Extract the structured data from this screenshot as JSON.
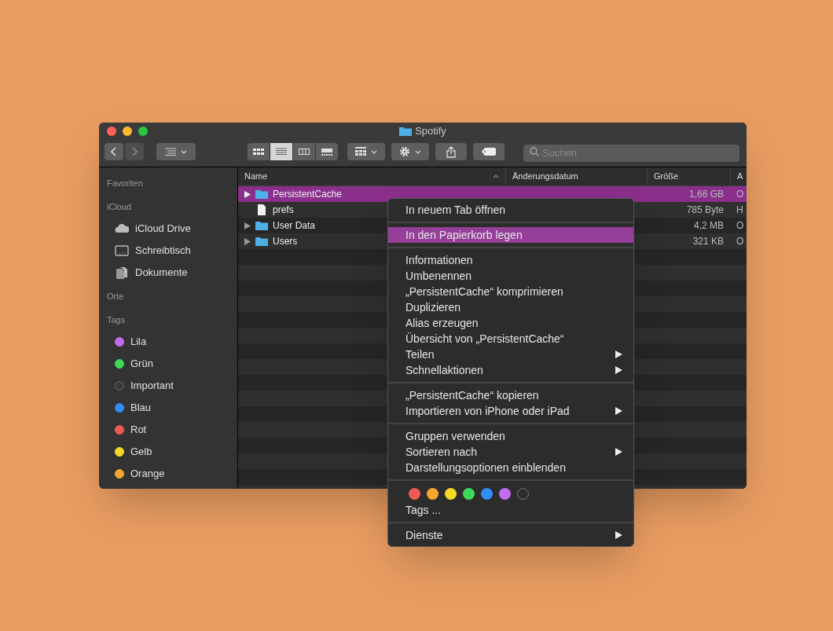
{
  "window": {
    "title": "Spotify"
  },
  "toolbar": {
    "view_modes": [
      {
        "kind": "icons",
        "selected": false
      },
      {
        "kind": "list",
        "selected": true
      },
      {
        "kind": "columns",
        "selected": false
      },
      {
        "kind": "gallery",
        "selected": false
      }
    ],
    "search": {
      "placeholder": "Suchen"
    }
  },
  "sidebar": {
    "sections": [
      {
        "title": "Favoriten"
      },
      {
        "title": "iCloud",
        "items": [
          {
            "label": "iCloud Drive",
            "kind": "cloud"
          },
          {
            "label": "Schreibtisch",
            "kind": "desktop"
          },
          {
            "label": "Dokumente",
            "kind": "documents"
          }
        ]
      },
      {
        "title": "Orte"
      },
      {
        "title": "Tags",
        "items": [
          {
            "label": "Lila",
            "color": "#c26cf0"
          },
          {
            "label": "Grün",
            "color": "#3fd95a"
          },
          {
            "label": "Important",
            "color": "#3a3a3a"
          },
          {
            "label": "Blau",
            "color": "#2f8ff5"
          },
          {
            "label": "Rot",
            "color": "#f05a55"
          },
          {
            "label": "Gelb",
            "color": "#f5d726"
          },
          {
            "label": "Orange",
            "color": "#f7a531"
          }
        ]
      }
    ]
  },
  "table": {
    "columns": [
      {
        "label": "Name",
        "sorted": true
      },
      {
        "label": "Änderungsdatum",
        "sorted": false
      },
      {
        "label": "Größe",
        "sorted": false
      },
      {
        "label": "A",
        "sorted": false
      }
    ],
    "rows": [
      {
        "name": "PersistentCache",
        "kind": "folder",
        "expandable": true,
        "selected": true,
        "size": "1,66 GB",
        "column_4": "O"
      },
      {
        "name": "prefs",
        "kind": "file",
        "expandable": false,
        "selected": false,
        "size": "785 Byte",
        "column_4": "H"
      },
      {
        "name": "User Data",
        "kind": "folder",
        "expandable": true,
        "selected": false,
        "size": "4,2 MB",
        "column_4": "O"
      },
      {
        "name": "Users",
        "kind": "folder",
        "expandable": true,
        "selected": false,
        "size": "321 KB",
        "column_4": "O"
      }
    ]
  },
  "context_menu": {
    "sections": [
      {
        "items": [
          {
            "label": "In neuem Tab öffnen",
            "selected": false,
            "submenu": false
          }
        ]
      },
      {
        "items": [
          {
            "label": "In den Papierkorb legen",
            "selected": true,
            "submenu": false
          }
        ]
      },
      {
        "items": [
          {
            "label": "Informationen",
            "selected": false,
            "submenu": false
          },
          {
            "label": "Umbenennen",
            "selected": false,
            "submenu": false
          },
          {
            "label": "„PersistentCache“ komprimieren",
            "selected": false,
            "submenu": false
          },
          {
            "label": "Duplizieren",
            "selected": false,
            "submenu": false
          },
          {
            "label": "Alias erzeugen",
            "selected": false,
            "submenu": false
          },
          {
            "label": "Übersicht von „PersistentCache“",
            "selected": false,
            "submenu": false
          },
          {
            "label": "Teilen",
            "selected": false,
            "submenu": true
          },
          {
            "label": "Schnellaktionen",
            "selected": false,
            "submenu": true
          }
        ]
      },
      {
        "items": [
          {
            "label": "„PersistentCache“ kopieren",
            "selected": false,
            "submenu": false
          },
          {
            "label": "Importieren von iPhone oder iPad",
            "selected": false,
            "submenu": true
          }
        ]
      },
      {
        "items": [
          {
            "label": "Gruppen verwenden",
            "selected": false,
            "submenu": false
          },
          {
            "label": "Sortieren nach",
            "selected": false,
            "submenu": true
          },
          {
            "label": "Darstellungsoptionen einblenden",
            "selected": false,
            "submenu": false
          }
        ]
      },
      {
        "tags": [
          {
            "kind": "dot",
            "color": "#f05a55"
          },
          {
            "kind": "dot",
            "color": "#f7a531"
          },
          {
            "kind": "dot",
            "color": "#f5d726"
          },
          {
            "kind": "dot",
            "color": "#3fd95a"
          },
          {
            "kind": "dot",
            "color": "#2f8ff5"
          },
          {
            "kind": "dot",
            "color": "#c26cf0"
          },
          {
            "kind": "ring"
          }
        ],
        "items": [
          {
            "label": "Tags ...",
            "selected": false,
            "submenu": false
          }
        ]
      },
      {
        "items": [
          {
            "label": "Dienste",
            "selected": false,
            "submenu": true
          }
        ]
      }
    ]
  }
}
